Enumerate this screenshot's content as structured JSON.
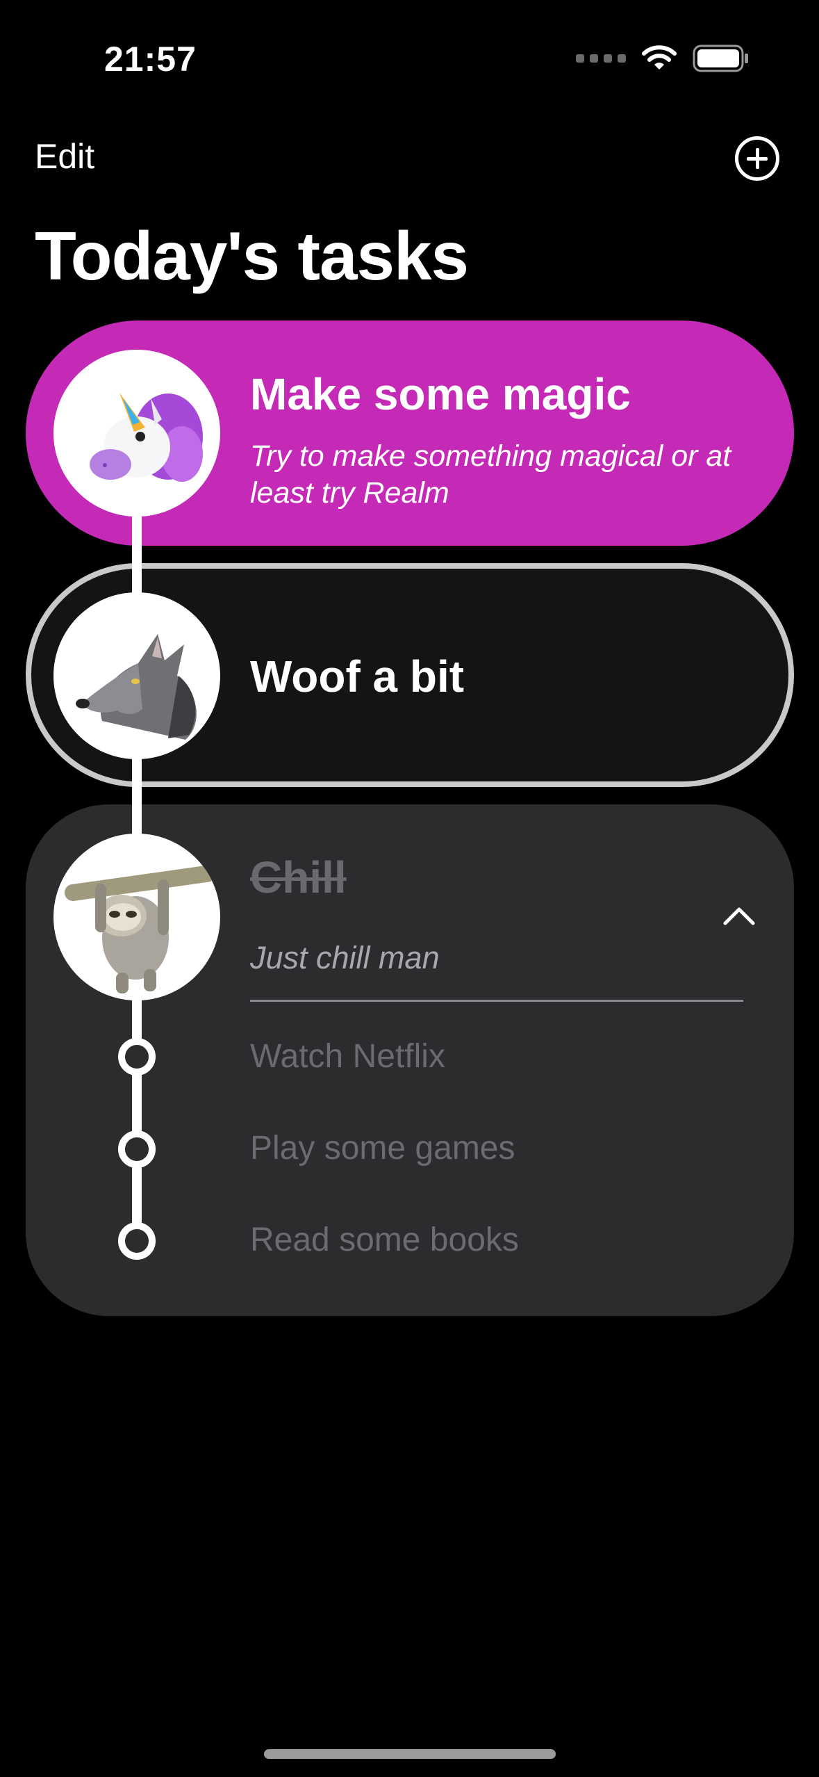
{
  "status_bar": {
    "time": "21:57",
    "icons": [
      "cellular-dots-icon",
      "wifi-icon",
      "battery-icon"
    ]
  },
  "nav": {
    "edit_label": "Edit",
    "add_icon": "plus-circle-icon"
  },
  "page": {
    "title": "Today's tasks"
  },
  "tasks": [
    {
      "title": "Make some magic",
      "subtitle": "Try to make something magical or at least try Realm",
      "emoji": "unicorn-icon",
      "color": "#c42ab6"
    },
    {
      "title": "Woof a bit",
      "emoji": "wolf-icon",
      "color": "#141414",
      "border": "#c9c9c9"
    },
    {
      "title": "Chill",
      "subtitle": "Just chill man",
      "emoji": "sloth-icon",
      "color": "#2c2c2e",
      "completed": true,
      "expanded": true,
      "subtasks": [
        {
          "label": "Watch Netflix"
        },
        {
          "label": "Play some games"
        },
        {
          "label": "Read some books"
        }
      ]
    }
  ]
}
